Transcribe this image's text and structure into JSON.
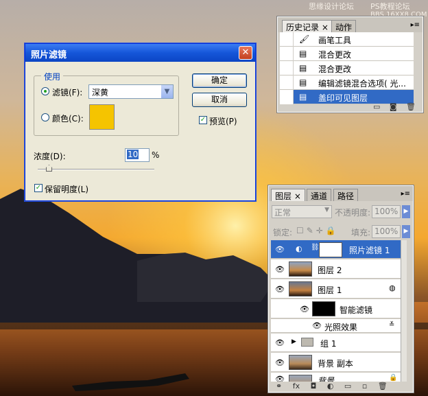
{
  "watermark": {
    "line1": "思缘设计论坛",
    "line2": "PS教程论坛",
    "line3": "BBS.16XX8.COM"
  },
  "dialog": {
    "title": "照片滤镜",
    "close": "✕",
    "group_label": "使用",
    "filter_label": "滤镜(F):",
    "filter_value": "深黄",
    "color_label": "颜色(C):",
    "color_hex": "#f5c400",
    "ok": "确定",
    "cancel": "取消",
    "preview": "预览(P)",
    "density_label": "浓度(D):",
    "density_value": "10",
    "percent": "%",
    "preserve": "保留明度(L)"
  },
  "history": {
    "tabs": [
      "历史记录",
      "动作"
    ],
    "tab_close": "×",
    "items": [
      "画笔工具",
      "混合更改",
      "混合更改",
      "编辑滤镜混合选项( 光...",
      "盖印可见图层"
    ]
  },
  "layers": {
    "tabs": [
      "图层",
      "通道",
      "路径"
    ],
    "blend": "正常",
    "opacity_label": "不透明度:",
    "opacity_value": "100%",
    "lock_label": "锁定:",
    "fill_label": "填充:",
    "fill_value": "100%",
    "items": [
      "照片滤镜 1",
      "图层 2",
      "图层 1",
      "智能滤镜",
      "光照效果",
      "组 1",
      "背景 副本",
      "背景"
    ],
    "footer_icons": "fx"
  },
  "colors": {
    "accent": "#316ac5",
    "title_bar": "#1556d9",
    "swatch": "#f5c400"
  }
}
